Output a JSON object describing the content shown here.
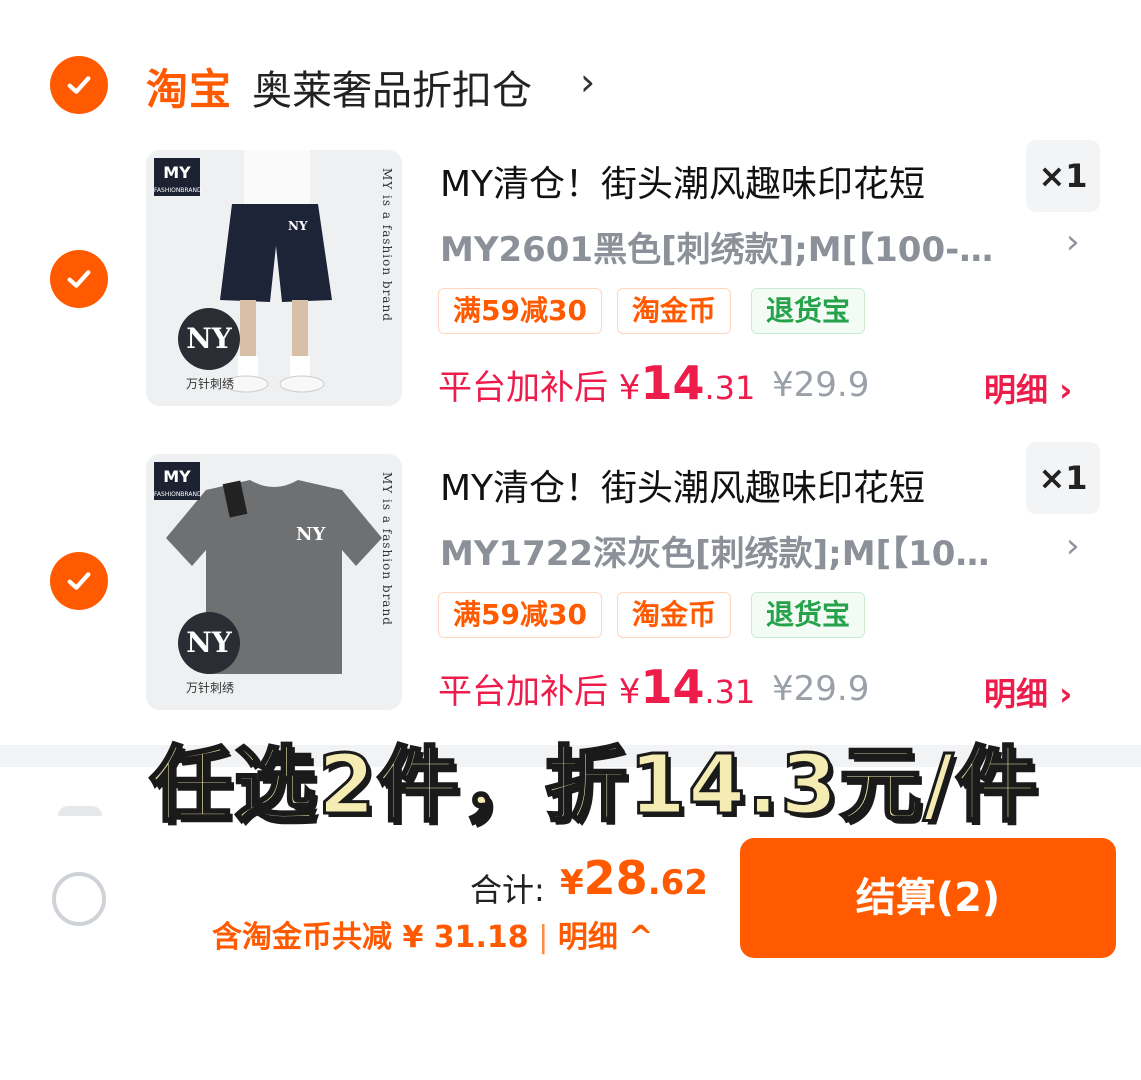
{
  "shop": {
    "logo": "淘宝",
    "name": "奥莱奢品折扣仓",
    "chevron": "›"
  },
  "items": [
    {
      "title": "MY清仓！街头潮风趣味印花短",
      "qty": "×1",
      "sku": "MY2601黑色[刺绣款];M[【100-…",
      "tags": [
        "满59减30",
        "淘金币",
        "退货宝"
      ],
      "price_prefix": "平台加补后 ¥",
      "price_int": "14",
      "price_dec": ".31",
      "price_old": "¥29.9",
      "detail": "明细 ›",
      "thumb": {
        "brand": "MY",
        "brand_sub": "FASHIONBRAND",
        "side_text": "MY is a fashion brand",
        "badge": "NY",
        "badge_label": "万针刺绣"
      }
    },
    {
      "title": "MY清仓！街头潮风趣味印花短",
      "qty": "×1",
      "sku": "MY1722深灰色[刺绣款];M[【10…",
      "tags": [
        "满59减30",
        "淘金币",
        "退货宝"
      ],
      "price_prefix": "平台加补后 ¥",
      "price_int": "14",
      "price_dec": ".31",
      "price_old": "¥29.9",
      "detail": "明细 ›",
      "thumb": {
        "brand": "MY",
        "brand_sub": "FASHIONBRAND",
        "side_text": "MY is a fashion brand",
        "badge": "NY",
        "badge_label": "万针刺绣"
      }
    }
  ],
  "promo_overlay": "任选2件，折14.3元/件",
  "footer": {
    "total_label": "合计:",
    "total_currency": "¥",
    "total_int": "28",
    "total_dec": ".62",
    "discount_text": "含淘金币共减 ¥ 31.18",
    "discount_sep": " | ",
    "discount_detail": "明细 ^",
    "checkout_label": "结算(2)"
  },
  "colors": {
    "accent": "#ff5a00",
    "price": "#ee1c4b",
    "green_tag": "#25a24a"
  }
}
